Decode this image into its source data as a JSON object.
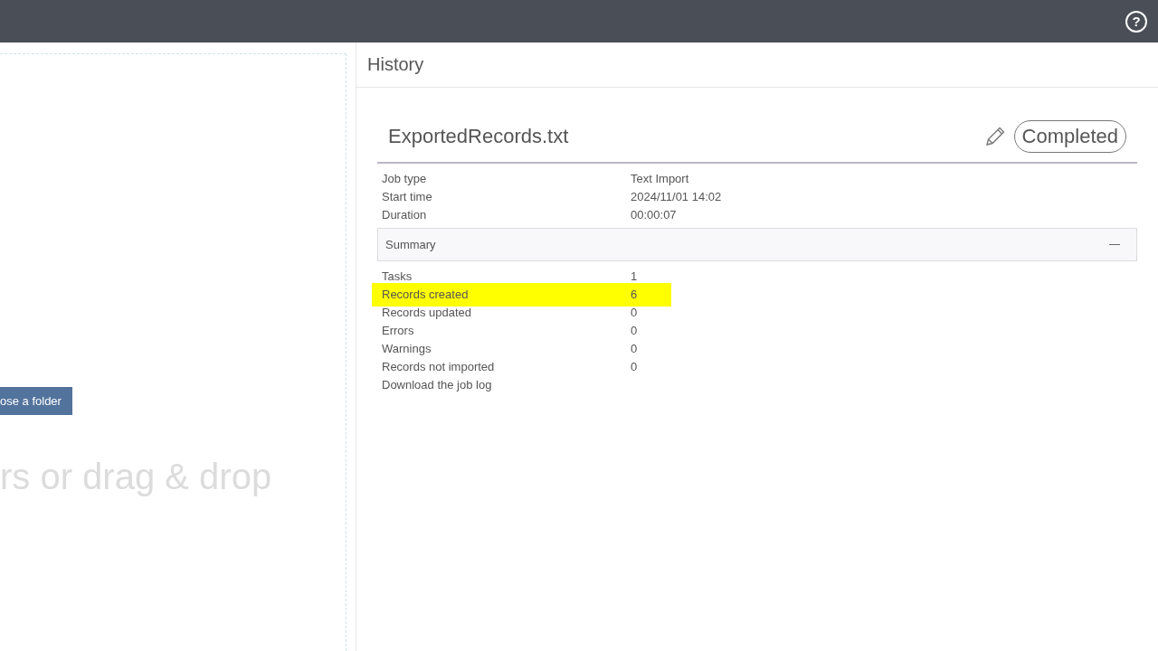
{
  "help_button": {
    "label": "?"
  },
  "upload": {
    "button": "ose a folder",
    "drop_hint": "rs or drag & drop"
  },
  "history": {
    "title": "History",
    "job": {
      "file_name": "ExportedRecords.txt",
      "status": "Completed",
      "details": [
        {
          "label": "Job type",
          "value": "Text Import"
        },
        {
          "label": "Start time",
          "value": "2024/11/01 14:02"
        },
        {
          "label": "Duration",
          "value": "00:00:07"
        }
      ],
      "summary": {
        "title": "Summary",
        "expanded": true,
        "rows": [
          {
            "label": "Tasks",
            "value": "1",
            "highlighted": false
          },
          {
            "label": "Records created",
            "value": "6",
            "highlighted": true
          },
          {
            "label": "Records updated",
            "value": "0",
            "highlighted": false
          },
          {
            "label": "Errors",
            "value": "0",
            "highlighted": false
          },
          {
            "label": "Warnings",
            "value": "0",
            "highlighted": false
          },
          {
            "label": "Records not imported",
            "value": "0",
            "highlighted": false
          }
        ],
        "link": "Download the job log"
      }
    }
  }
}
